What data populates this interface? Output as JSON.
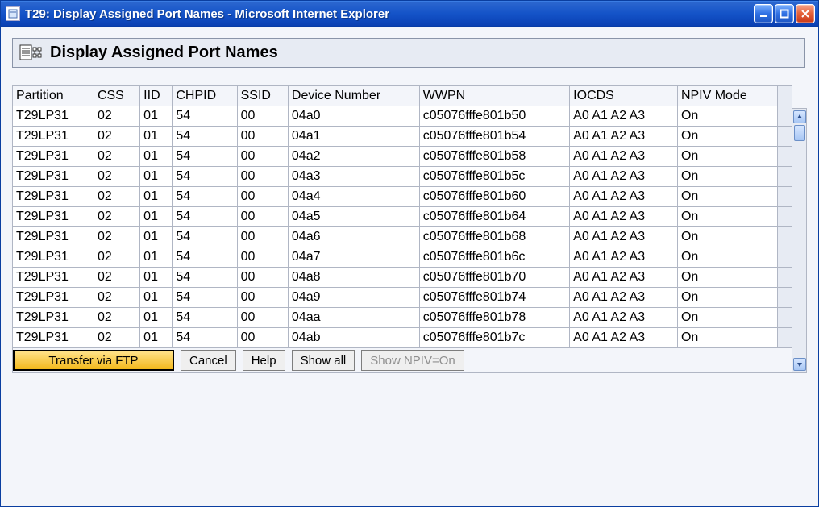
{
  "window": {
    "title": "T29: Display Assigned Port Names - Microsoft Internet Explorer"
  },
  "panel": {
    "title": "Display Assigned Port Names"
  },
  "table": {
    "headers": [
      "Partition",
      "CSS",
      "IID",
      "CHPID",
      "SSID",
      "Device Number",
      "WWPN",
      "IOCDS",
      "NPIV Mode"
    ],
    "rows": [
      {
        "partition": "T29LP31",
        "css": "02",
        "iid": "01",
        "chpid": "54",
        "ssid": "00",
        "devnum": "04a0",
        "wwpn": "c05076fffe801b50",
        "iocds": "A0 A1 A2 A3",
        "npiv": "On"
      },
      {
        "partition": "T29LP31",
        "css": "02",
        "iid": "01",
        "chpid": "54",
        "ssid": "00",
        "devnum": "04a1",
        "wwpn": "c05076fffe801b54",
        "iocds": "A0 A1 A2 A3",
        "npiv": "On"
      },
      {
        "partition": "T29LP31",
        "css": "02",
        "iid": "01",
        "chpid": "54",
        "ssid": "00",
        "devnum": "04a2",
        "wwpn": "c05076fffe801b58",
        "iocds": "A0 A1 A2 A3",
        "npiv": "On"
      },
      {
        "partition": "T29LP31",
        "css": "02",
        "iid": "01",
        "chpid": "54",
        "ssid": "00",
        "devnum": "04a3",
        "wwpn": "c05076fffe801b5c",
        "iocds": "A0 A1 A2 A3",
        "npiv": "On"
      },
      {
        "partition": "T29LP31",
        "css": "02",
        "iid": "01",
        "chpid": "54",
        "ssid": "00",
        "devnum": "04a4",
        "wwpn": "c05076fffe801b60",
        "iocds": "A0 A1 A2 A3",
        "npiv": "On"
      },
      {
        "partition": "T29LP31",
        "css": "02",
        "iid": "01",
        "chpid": "54",
        "ssid": "00",
        "devnum": "04a5",
        "wwpn": "c05076fffe801b64",
        "iocds": "A0 A1 A2 A3",
        "npiv": "On"
      },
      {
        "partition": "T29LP31",
        "css": "02",
        "iid": "01",
        "chpid": "54",
        "ssid": "00",
        "devnum": "04a6",
        "wwpn": "c05076fffe801b68",
        "iocds": "A0 A1 A2 A3",
        "npiv": "On"
      },
      {
        "partition": "T29LP31",
        "css": "02",
        "iid": "01",
        "chpid": "54",
        "ssid": "00",
        "devnum": "04a7",
        "wwpn": "c05076fffe801b6c",
        "iocds": "A0 A1 A2 A3",
        "npiv": "On"
      },
      {
        "partition": "T29LP31",
        "css": "02",
        "iid": "01",
        "chpid": "54",
        "ssid": "00",
        "devnum": "04a8",
        "wwpn": "c05076fffe801b70",
        "iocds": "A0 A1 A2 A3",
        "npiv": "On"
      },
      {
        "partition": "T29LP31",
        "css": "02",
        "iid": "01",
        "chpid": "54",
        "ssid": "00",
        "devnum": "04a9",
        "wwpn": "c05076fffe801b74",
        "iocds": "A0 A1 A2 A3",
        "npiv": "On"
      },
      {
        "partition": "T29LP31",
        "css": "02",
        "iid": "01",
        "chpid": "54",
        "ssid": "00",
        "devnum": "04aa",
        "wwpn": "c05076fffe801b78",
        "iocds": "A0 A1 A2 A3",
        "npiv": "On"
      },
      {
        "partition": "T29LP31",
        "css": "02",
        "iid": "01",
        "chpid": "54",
        "ssid": "00",
        "devnum": "04ab",
        "wwpn": "c05076fffe801b7c",
        "iocds": "A0 A1 A2 A3",
        "npiv": "On"
      }
    ]
  },
  "buttons": {
    "transfer": "Transfer via FTP",
    "cancel": "Cancel",
    "help": "Help",
    "showall": "Show all",
    "shownpiv": "Show NPIV=On"
  }
}
